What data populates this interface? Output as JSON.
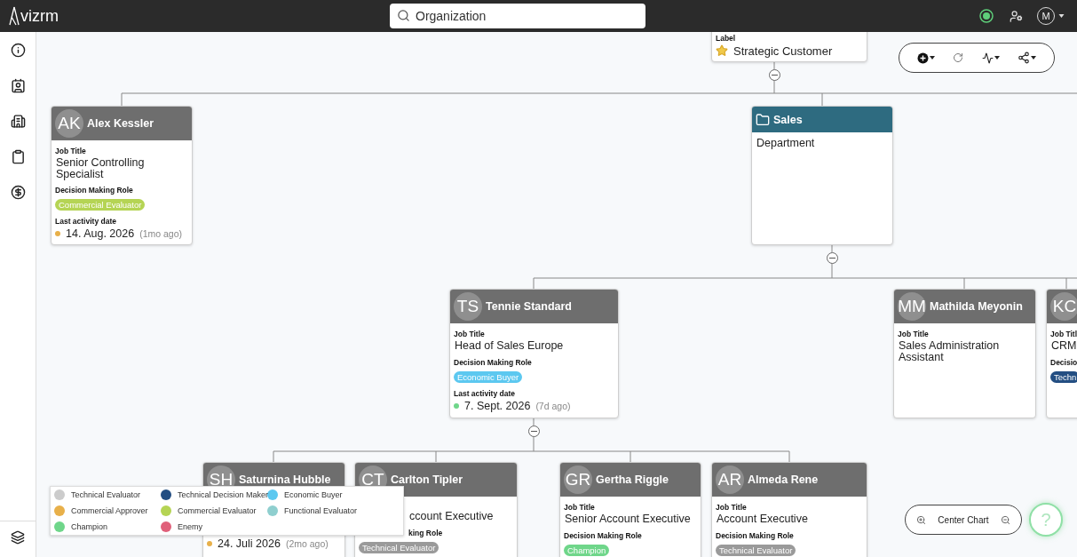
{
  "app": {
    "logo": "vizrm",
    "search": {
      "value": "Organization"
    },
    "user_initial": "M"
  },
  "cards": [
    {
      "kind": "label",
      "sections": [
        {
          "kind": "label",
          "text": "Label"
        },
        {
          "kind": "starred",
          "text": "Strategic Customer"
        }
      ]
    },
    {
      "kind": "person",
      "initials": "AK",
      "name": "Alex Kessler",
      "sections": [
        {
          "kind": "label",
          "text": "Job Title"
        },
        {
          "kind": "text",
          "text": "Senior Controlling Specialist"
        },
        {
          "kind": "label",
          "text": "Decision Making Role"
        },
        {
          "kind": "chip",
          "text": "Commercial Evaluator",
          "color": "#b5d454"
        },
        {
          "kind": "label",
          "text": "Last activity date"
        },
        {
          "kind": "date",
          "text": "14. Aug. 2026",
          "ago": "(1mo ago)",
          "color": "#e8b04a"
        }
      ]
    },
    {
      "kind": "department",
      "name": "Sales",
      "sections": [
        {
          "kind": "text",
          "text": "Department"
        }
      ]
    },
    {
      "kind": "person",
      "initials": "TS",
      "name": "Tennie Standard",
      "sections": [
        {
          "kind": "label",
          "text": "Job Title"
        },
        {
          "kind": "text",
          "text": "Head of Sales Europe"
        },
        {
          "kind": "label",
          "text": "Decision Making Role"
        },
        {
          "kind": "chip",
          "text": "Economic Buyer",
          "color": "#5cc8f0"
        },
        {
          "kind": "label",
          "text": "Last activity date"
        },
        {
          "kind": "date",
          "text": "7. Sept. 2026",
          "ago": "(7d ago)",
          "color": "#6fd68a"
        }
      ]
    },
    {
      "kind": "person",
      "initials": "MM",
      "name": "Mathilda Meyonin",
      "sections": [
        {
          "kind": "label",
          "text": "Job Title"
        },
        {
          "kind": "text",
          "text": "Sales Administration Assistant"
        }
      ]
    },
    {
      "kind": "person",
      "initials": "KC",
      "sections": [
        {
          "kind": "label",
          "text": "Job Titl"
        },
        {
          "kind": "text",
          "text": "CRM"
        },
        {
          "kind": "label",
          "text": "Decisio"
        },
        {
          "kind": "chip",
          "text": "Techn",
          "color": "#234e82"
        }
      ]
    },
    {
      "kind": "person",
      "initials": "SH",
      "name": "Saturnina Hubble",
      "sections": [
        {
          "kind": "date",
          "text": "24. Juli 2026",
          "ago": "(2mo ago)",
          "color": "#e8b04a"
        }
      ]
    },
    {
      "kind": "person",
      "initials": "CT",
      "name": "Carlton Tipler",
      "sections": [
        {
          "kind": "text",
          "text": "ccount Executive"
        },
        {
          "kind": "label",
          "text": "king Role"
        },
        {
          "kind": "chip",
          "text": "Technical Evaluator",
          "color": "#9a9a9a"
        }
      ]
    },
    {
      "kind": "person",
      "initials": "GR",
      "name": "Gertha Riggle",
      "sections": [
        {
          "kind": "label",
          "text": "Job Title"
        },
        {
          "kind": "text",
          "text": "Senior Account Executive"
        },
        {
          "kind": "label",
          "text": "Decision Making Role"
        },
        {
          "kind": "chip",
          "text": "Champion",
          "color": "#6fd68a"
        }
      ]
    },
    {
      "kind": "person",
      "initials": "AR",
      "name": "Almeda Rene",
      "sections": [
        {
          "kind": "label",
          "text": "Job Title"
        },
        {
          "kind": "text",
          "text": "Account Executive"
        },
        {
          "kind": "label",
          "text": "Decision Making Role"
        },
        {
          "kind": "chip",
          "text": "Technical Evaluator",
          "color": "#9a9a9a"
        }
      ]
    }
  ],
  "legend": [
    {
      "label": "Technical Evaluator",
      "color": "#cccccc"
    },
    {
      "label": "Technical Decision Maker",
      "color": "#234e82"
    },
    {
      "label": "Economic Buyer",
      "color": "#5cc8f0"
    },
    {
      "label": "Commercial Approver",
      "color": "#e8b04a"
    },
    {
      "label": "Commercial Evaluator",
      "color": "#b5d454"
    },
    {
      "label": "Functional Evaluator",
      "color": "#8fcfcf"
    },
    {
      "label": "Champion",
      "color": "#6fd68a"
    },
    {
      "label": "Enemy",
      "color": "#e0607a"
    }
  ],
  "zoom_bar": {
    "label": "Center Chart"
  },
  "help": {
    "label": "?"
  }
}
